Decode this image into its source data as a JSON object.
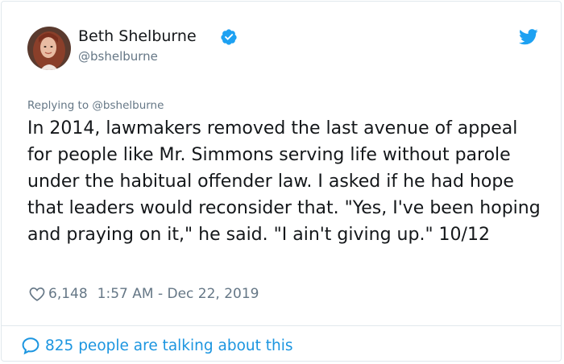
{
  "author": {
    "name": "Beth Shelburne",
    "handle": "@bshelburne",
    "verified": true
  },
  "replying": {
    "prefix": "Replying to",
    "to": "@bshelburne"
  },
  "tweet": {
    "text": "In 2014, lawmakers removed the last avenue of appeal for people like Mr. Simmons serving life without parole under the habitual offender law. I asked if he had hope that leaders would reconsider that. \"Yes, I've been hoping and praying on it,\" he said. \"I ain't giving up.\" 10/12",
    "likes": "6,148",
    "timestamp": "1:57 AM - Dec 22, 2019"
  },
  "footer": {
    "talking": "825 people are talking about this"
  },
  "icons": {
    "verified": "verified-badge-icon",
    "logo": "twitter-bird-icon",
    "like": "heart-icon",
    "talking": "speech-bubble-icon"
  },
  "colors": {
    "brand": "#1da1f2",
    "link": "#1b95e0",
    "secondary_text": "#657786",
    "primary_text": "#14171a",
    "border": "#e1e8ed"
  }
}
